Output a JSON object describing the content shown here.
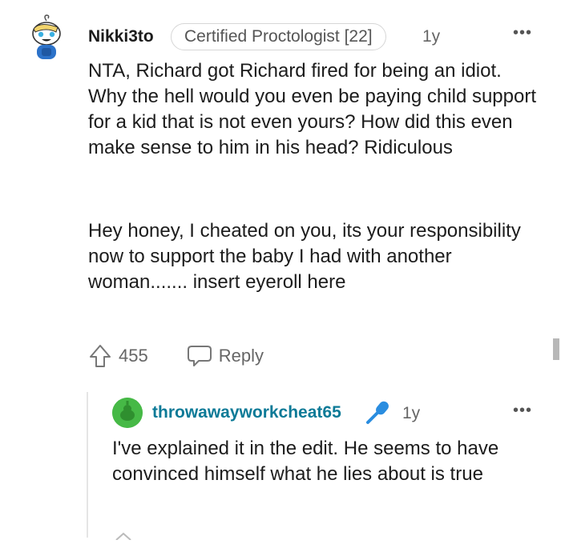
{
  "comment": {
    "username": "Nikki3to",
    "flair": "Certified Proctologist [22]",
    "age": "1y",
    "more_icon": "•••",
    "paragraphs": [
      "NTA, Richard got Richard fired for being an idiot. Why the hell would you even be paying child support for a kid that is not even yours? How did this even make sense to him in his head? Ridiculous",
      "Hey honey, I cheated on you, its your responsibility now to support the baby I had with another woman....... insert eyeroll here"
    ],
    "upvotes": "455",
    "reply_label": "Reply"
  },
  "reply": {
    "username": "throwawayworkcheat65",
    "age": "1y",
    "more_icon": "•••",
    "body": "I've explained it in the edit. He seems to have convinced himself what he lies about is true"
  },
  "icons": {
    "upvote": "upvote-arrow-icon",
    "reply": "speech-bubble-icon",
    "mic": "microphone-icon"
  },
  "colors": {
    "reply_username": "#0c7a97",
    "reply_avatar": "#46b946",
    "mic_icon": "#2a8de0"
  }
}
